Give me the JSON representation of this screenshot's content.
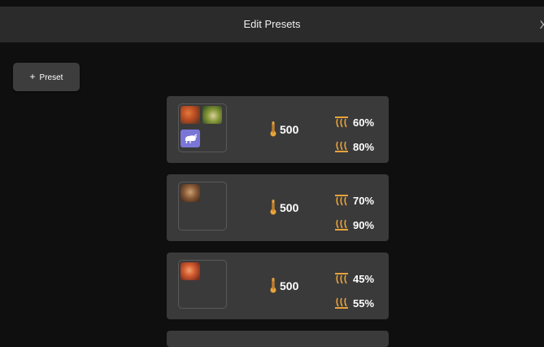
{
  "header": {
    "title": "Edit Presets",
    "close_label": "X"
  },
  "toolbar": {
    "add_label": "Preset",
    "add_icon": "plus-icon"
  },
  "presets": [
    {
      "thumbnails": [
        "food-photo",
        "food-photo",
        "chicken-icon"
      ],
      "temperature": "500",
      "top_heat": "60%",
      "bottom_heat": "80%"
    },
    {
      "thumbnails": [
        "food-photo"
      ],
      "temperature": "500",
      "top_heat": "70%",
      "bottom_heat": "90%"
    },
    {
      "thumbnails": [
        "food-photo"
      ],
      "temperature": "500",
      "top_heat": "45%",
      "bottom_heat": "55%"
    }
  ],
  "colors": {
    "accent": "#e8a33a",
    "card": "#3a3a3a",
    "background": "#0f0f0f"
  }
}
